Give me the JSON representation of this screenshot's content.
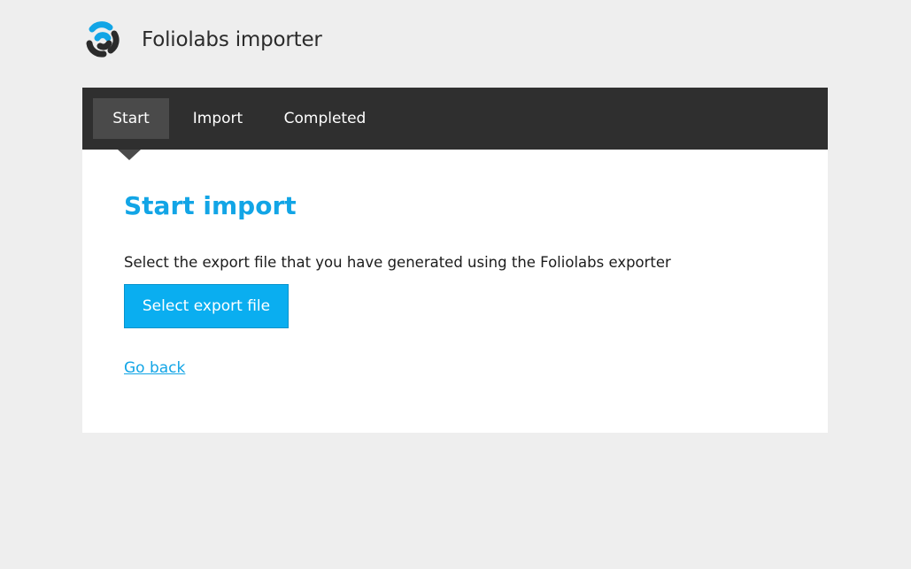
{
  "header": {
    "logo_icon": "swirl-logo-icon",
    "title": "Foliolabs importer"
  },
  "nav": {
    "tabs": [
      {
        "label": "Start",
        "active": true
      },
      {
        "label": "Import",
        "active": false
      },
      {
        "label": "Completed",
        "active": false
      }
    ]
  },
  "main": {
    "title": "Start import",
    "description": "Select the export file that you have generated using the Foliolabs exporter",
    "select_button_label": "Select export file",
    "go_back_label": "Go back"
  },
  "colors": {
    "accent": "#0aaef0",
    "nav_background": "#2f2f2f",
    "active_tab": "#4a4a4a",
    "page_background": "#eeeeee"
  }
}
